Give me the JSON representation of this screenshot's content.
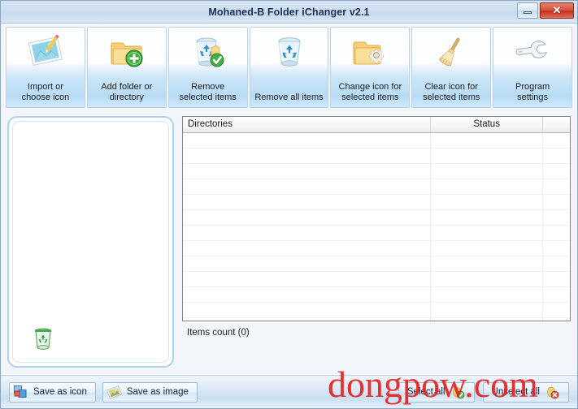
{
  "window": {
    "title": "Mohaned-B Folder iChanger v2.1",
    "controls": [
      {
        "name": "minimize",
        "label": ""
      },
      {
        "name": "close",
        "label": "✕"
      }
    ]
  },
  "toolbar": {
    "buttons": [
      {
        "id": "import-or-choose-icon",
        "label": "Import or\nchoose icon",
        "icon": "picture-icon"
      },
      {
        "id": "add-folder-or-directory",
        "label": "Add folder or\ndirectory",
        "icon": "folder-add-icon"
      },
      {
        "id": "remove-selected-items",
        "label": "Remove\nselected items",
        "icon": "recycle-bin-check-icon"
      },
      {
        "id": "remove-all-items",
        "label": "Remove all items",
        "icon": "recycle-bin-icon"
      },
      {
        "id": "change-icon-for-selected",
        "label": "Change icon for\nselected items",
        "icon": "folder-gear-icon"
      },
      {
        "id": "clear-icon-for-selected",
        "label": "Clear icon for\nselected items",
        "icon": "broom-icon"
      },
      {
        "id": "program-settings",
        "label": "Program\nsettings",
        "icon": "wrench-icon"
      }
    ]
  },
  "preview": {
    "icon_name": "recycle-bin-green-icon"
  },
  "list": {
    "columns": [
      "Directories",
      "Status",
      ""
    ],
    "rows": [],
    "empty_row_count": 13,
    "items_count_label": "Items count (0)"
  },
  "bottom": {
    "save_as_icon": {
      "label": "Save as icon",
      "icon": "save-icon-icon"
    },
    "save_as_image": {
      "label": "Save as image",
      "icon": "save-image-icon"
    },
    "select_all": {
      "label": "Select all",
      "icon": "select-all-icon"
    },
    "unselect_all": {
      "label": "Unselect all",
      "icon": "unselect-all-icon"
    }
  },
  "watermark": {
    "text": "dongpow.com",
    "color": "#e8201f"
  },
  "colors": {
    "title_bar": "#cfdff0",
    "accent": "#b8dcf6",
    "frame_border": "#8ba7c4",
    "close_button": "#c0301a"
  }
}
